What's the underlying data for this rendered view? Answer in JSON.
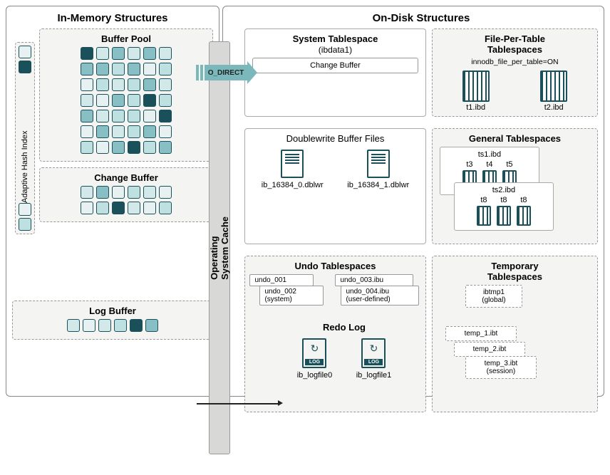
{
  "sections": {
    "in_memory": {
      "title": "In-Memory Structures"
    },
    "on_disk": {
      "title": "On-Disk Structures"
    }
  },
  "in_memory": {
    "ahi_label": "Adaptive Hash Index",
    "buffer_pool": {
      "title": "Buffer Pool"
    },
    "change_buffer": {
      "title": "Change Buffer"
    },
    "log_buffer": {
      "title": "Log Buffer"
    },
    "os_cache": {
      "label": "Operating\nSystem Cache"
    },
    "o_direct": "O_DIRECT"
  },
  "on_disk": {
    "system_tablespace": {
      "title": "System Tablespace",
      "subtitle": "(ibdata1)",
      "change_buffer_label": "Change Buffer"
    },
    "file_per_table": {
      "title": "File-Per-Table\nTablespaces",
      "config": "innodb_file_per_table=ON",
      "files": [
        "t1.ibd",
        "t2.ibd"
      ]
    },
    "doublewrite": {
      "title": "Doublewrite Buffer Files",
      "files": [
        "ib_16384_0.dblwr",
        "ib_16384_1.dblwr"
      ]
    },
    "general_tablespaces": {
      "title": "General Tablespaces",
      "ts1": {
        "name": "ts1.ibd",
        "tables": [
          "t3",
          "t4",
          "t5"
        ]
      },
      "ts2": {
        "name": "ts2.ibd",
        "tables": [
          "t8",
          "t8",
          "t8"
        ]
      }
    },
    "undo": {
      "title": "Undo Tablespaces",
      "undo_001": "undo_001",
      "undo_002": "undo_002\n(system)",
      "undo_003": "undo_003.ibu",
      "undo_004": "undo_004.ibu\n(user-defined)"
    },
    "redo": {
      "title": "Redo Log",
      "files": [
        "ib_logfile0",
        "ib_logfile1"
      ]
    },
    "temporary": {
      "title": "Temporary\nTablespaces",
      "global": "ibtmp1\n(global)",
      "temp1": "temp_1.ibt",
      "temp2": "temp_2.ibt",
      "temp3": "temp_3.ibt\n(session)"
    }
  }
}
